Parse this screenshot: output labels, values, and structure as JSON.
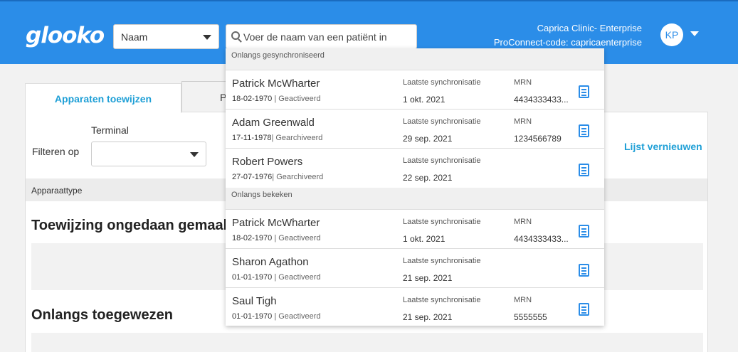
{
  "header": {
    "logo": "glooko",
    "search_type": "Naam",
    "search_placeholder": "Voer de naam van een patiënt in",
    "clinic_name": "Caprica Clinic- Enterprise",
    "proconnect_code": "ProConnect-code: capricaenterprise",
    "avatar_initials": "KP",
    "brand_color": "#2b8de8"
  },
  "tabs": {
    "active": "Apparaten toewijzen",
    "inactive": "P"
  },
  "filter": {
    "filter_label": "Filteren op",
    "terminal_label": "Terminal",
    "terminal_value": "",
    "refresh_link": "Lijst vernieuwen"
  },
  "table": {
    "device_type_header": "Apparaattype"
  },
  "sections": {
    "undone_title": "Toewijzing ongedaan gemaakt",
    "recent_title": "Onlangs toegewezen"
  },
  "dropdown": {
    "synced_header": "Onlangs gesynchroniseerd",
    "viewed_header": "Onlangs bekeken",
    "sync_label": "Laatste synchronisatie",
    "mrn_label": "MRN",
    "synced": [
      {
        "name": "Patrick McWharter",
        "dob": "18-02-1970",
        "status": " | Geactiveerd",
        "sync_date": "1 okt. 2021",
        "mrn": "4434333433...",
        "show_mrn": true,
        "icon": "document-icon"
      },
      {
        "name": "Adam Greenwald",
        "dob": "17-11-1978",
        "status": "| Gearchiveerd",
        "sync_date": "29 sep. 2021",
        "mrn": "1234566789",
        "show_mrn": true,
        "icon": "document-icon"
      },
      {
        "name": "Robert Powers",
        "dob": "27-07-1976",
        "status": "| Gearchiveerd",
        "sync_date": "22 sep. 2021",
        "mrn": "",
        "show_mrn": false,
        "icon": "document-icon"
      }
    ],
    "viewed": [
      {
        "name": "Patrick McWharter",
        "dob": "18-02-1970",
        "status": " | Geactiveerd",
        "sync_date": "1 okt. 2021",
        "mrn": "4434333433...",
        "show_mrn": true,
        "icon": "document-icon"
      },
      {
        "name": "Sharon Agathon",
        "dob": "01-01-1970",
        "status": " | Geactiveerd",
        "sync_date": "21 sep. 2021",
        "mrn": "",
        "show_mrn": false,
        "icon": "document-icon"
      },
      {
        "name": "Saul Tigh",
        "dob": "01-01-1970",
        "status": " | Geactiveerd",
        "sync_date": "21 sep. 2021",
        "mrn": "5555555",
        "show_mrn": true,
        "icon": "document-icon"
      }
    ]
  }
}
